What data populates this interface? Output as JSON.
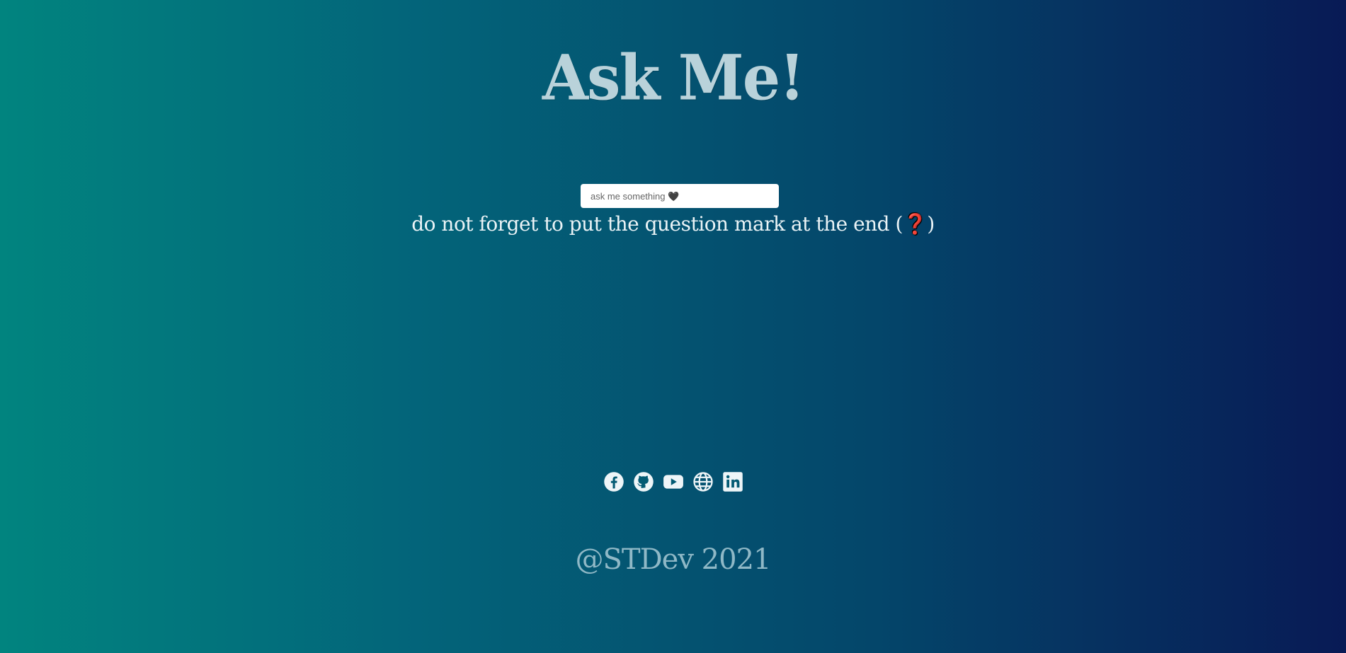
{
  "header": {
    "title": "Ask Me!"
  },
  "search": {
    "placeholder": "ask me something 🖤"
  },
  "hint": {
    "text": "do not forget to put the question mark at the end (",
    "icon": "❓",
    "close": ")"
  },
  "socials": [
    {
      "name": "facebook-icon"
    },
    {
      "name": "github-icon"
    },
    {
      "name": "youtube-icon"
    },
    {
      "name": "globe-icon"
    },
    {
      "name": "linkedin-icon"
    }
  ],
  "footer": {
    "text": "@STDev 2021"
  },
  "colors": {
    "gradient_start": "#01847f",
    "gradient_end": "#081a55",
    "title": "#b9d2da",
    "icon": "#eef5f8",
    "footer": "#8fb8c6"
  }
}
